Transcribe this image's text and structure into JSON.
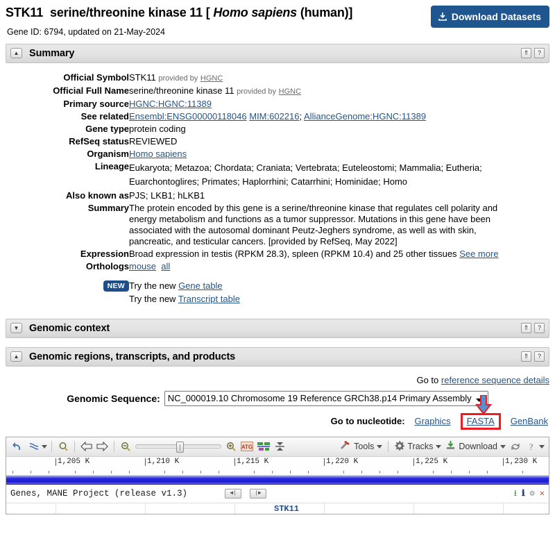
{
  "header": {
    "symbol": "STK11",
    "full_name": "serine/threonine kinase 11",
    "species_prefix": "[",
    "species": "Homo sapiens",
    "species_common": "(human)",
    "species_suffix": "]",
    "gene_id_line": "Gene ID: 6794, updated on 21-May-2024",
    "download_button": "Download Datasets",
    "download_icon": "download-icon",
    "accent_color": "#20568f"
  },
  "sections": {
    "summary": {
      "title": "Summary",
      "toggle_icon": "triangle-up-icon",
      "collapse_icon": "double-chevron-up-icon",
      "help_icon": "question-mark-icon"
    },
    "genomic_context": {
      "title": "Genomic context",
      "toggle_icon": "triangle-down-icon",
      "collapse_icon": "double-chevron-up-icon",
      "help_icon": "question-mark-icon"
    },
    "genomic_regions": {
      "title": "Genomic regions, transcripts, and products",
      "toggle_icon": "triangle-up-icon",
      "collapse_icon": "double-chevron-up-icon",
      "help_icon": "question-mark-icon"
    }
  },
  "summary": {
    "official_symbol": {
      "label": "Official Symbol",
      "value": "STK11",
      "provided_by_text": "provided by",
      "provided_by_link": "HGNC"
    },
    "official_full_name": {
      "label": "Official Full Name",
      "value": "serine/threonine kinase 11",
      "provided_by_text": "provided by",
      "provided_by_link": "HGNC"
    },
    "primary_source": {
      "label": "Primary source",
      "value": "HGNC:HGNC:11389"
    },
    "see_related": {
      "label": "See related",
      "links": [
        "Ensembl:ENSG00000118046",
        "MIM:602216",
        "AllianceGenome:HGNC:11389"
      ],
      "separator": "; "
    },
    "gene_type": {
      "label": "Gene type",
      "value": "protein coding"
    },
    "refseq_status": {
      "label": "RefSeq status",
      "value": "REVIEWED"
    },
    "organism": {
      "label": "Organism",
      "value": "Homo sapiens"
    },
    "lineage": {
      "label": "Lineage",
      "value": "Eukaryota; Metazoa; Chordata; Craniata; Vertebrata; Euteleostomi; Mammalia; Eutheria; Euarchontoglires; Primates; Haplorrhini; Catarrhini; Hominidae; Homo"
    },
    "also_known_as": {
      "label": "Also known as",
      "value": "PJS; LKB1; hLKB1"
    },
    "summary_text": {
      "label": "Summary",
      "value": "The protein encoded by this gene is a serine/threonine kinase that regulates cell polarity and energy metabolism and functions as a tumor suppressor. Mutations in this gene have been associated with the autosomal dominant Peutz-Jeghers syndrome, as well as with skin, pancreatic, and testicular cancers. [provided by RefSeq, May 2022]"
    },
    "expression": {
      "label": "Expression",
      "value": "Broad expression in testis (RPKM 28.3), spleen (RPKM 10.4) and 25 other tissues",
      "see_more": "See more"
    },
    "orthologs": {
      "label": "Orthologs",
      "link_mouse": "mouse",
      "link_all": "all"
    },
    "new_badge": "NEW",
    "try_gene": {
      "prefix": "Try the new",
      "link": "Gene table"
    },
    "try_transcript": {
      "prefix": "Try the new",
      "link": "Transcript table"
    }
  },
  "genomic_regions": {
    "goto_prefix": "Go to",
    "goto_link": "reference sequence details",
    "sequence_label": "Genomic Sequence:",
    "sequence_value": "NC_000019.10 Chromosome 19 Reference GRCh38.p14 Primary Assembly",
    "nucleotide_label": "Go to nucleotide:",
    "nuc_graphics": "Graphics",
    "nuc_fasta": "FASTA",
    "nuc_genbank": "GenBank",
    "highlight_color": "#ec1c24",
    "arrow_color": "#5b8fc9",
    "arrow_icon": "down-arrow-annotation-icon"
  },
  "viewer": {
    "toolbar": {
      "undo_icon": "undo-arrow-icon",
      "tangle_icon": "flip-strands-icon",
      "search_icon": "magnifier-icon",
      "back_icon": "left-arrow-icon",
      "forward_icon": "right-arrow-icon",
      "zoom_out_icon": "zoom-out-icon",
      "zoom_in_icon": "zoom-in-icon",
      "atg_icon": "atg-codon-icon",
      "alignment_icon": "alignment-track-icon",
      "collapse_icon": "collapse-tracks-icon",
      "tools_label": "Tools",
      "tools_icon": "tools-hammer-icon",
      "tracks_label": "Tracks",
      "tracks_icon": "gear-icon",
      "download_label": "Download",
      "download_icon": "download-icon",
      "refresh_icon": "refresh-icon",
      "help_icon": "question-mark-icon"
    },
    "ruler_ticks": [
      "1,205 K",
      "1,210 K",
      "1,215 K",
      "1,220 K",
      "1,225 K",
      "1,230 K"
    ],
    "track_title": "Genes, MANE Project (release v1.3)",
    "pager_prev_icon": "page-first-icon",
    "pager_next_icon": "page-last-icon",
    "track_icons": [
      "download-icon",
      "info-icon",
      "gear-icon",
      "close-icon"
    ],
    "gene_label": "STK11"
  }
}
